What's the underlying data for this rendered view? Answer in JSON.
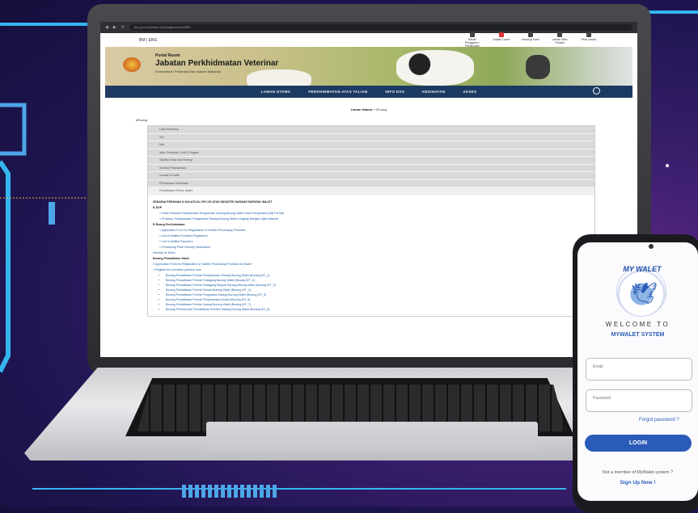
{
  "browser": {
    "url": "dvs.gov.my/index.php/pages/view/3805"
  },
  "gov_bar": {
    "left": "BM | ENG",
    "items": [
      "Aduan Pengguna / Pertanyaan",
      "Soalan Lazim",
      "Hubungi Kami",
      "Laman Web Pautan",
      "Peta Laman"
    ]
  },
  "header": {
    "portal": "Portal Rasmi",
    "title": "Jabatan Perkhidmatan Veterinar",
    "subtitle": "Kementerian Pertanian Dan Industri Makanan"
  },
  "nav": {
    "items": [
      "LAMAN UTAMA",
      "PERKHIDMATAN ATAS TALIAN",
      "INFO DVS",
      "KESIHATAN",
      "AKSES"
    ]
  },
  "breadcrumb": {
    "home": "Laman Utama",
    "current": "» eRuang"
  },
  "page_title": "eRuang",
  "accordion": {
    "items": [
      "Latar Belakang",
      "Visi",
      "Misi",
      "Akta, Peraturan, Unit & Piagam",
      "Takrifan Khas dan Strategi",
      "Senarai Pelaksanaan",
      "Inovasi & Kualiti",
      "Pendaftaran Kesihatan",
      "Pendaftaran Premis Walet"
    ],
    "body_title": "SENARAI PERANAN & HALATUJU JPV KE ATAS INDUSTRI SARANG BURUNG WALET",
    "e_sop": "E-SOP",
    "sop1": "» Garis Panduan Pelaksanaan Pengurusan Sarang Burung Walet untuk Pengusaha (Sijil Permit)",
    "sop2": "» Prosedur Pelaksanaan Pengeluaran Sarang Burung Walet Lengkap Dengan Ujian Makmal",
    "eruang": "E-Ruang Perkhidmatan",
    "er1": "» Application Form for Registration of Swiftlet Processing Premises",
    "er2": "» List of Swiftlet Premises Registered",
    "er3": "» List of Swiftlet Exporters",
    "er4": "» Processing Plant Security Information",
    "back": "Kembali ke Menu",
    "borang": "Borang Pendaftaran Walet",
    "note1": "» Application Form for Registration of Swiftlet Processing Premises for Walet",
    "note2": "» Register the premises premise here",
    "list": [
      "Borang Pendaftaran Premis Pemprosesan Sarang Burung Walet (Borang WT_1)",
      "Borang Pendaftaran Premis Pedagang Burung Walet (Borang WT_2)",
      "Borang Pendaftaran Premis Pedagang Eksport Sarang Burung Walet (Borang WT_3)",
      "Borang Pendaftaran Premis Rumah Burung Walet (Borang WT_4)",
      "Borang Pendaftaran Premis Pengusaha Sarang Burung Walet (Borang WT_5)",
      "Borang Pendaftaran Premis Pemprosesan Kedua (Borang WT_6)",
      "Borang Pendaftaran Premis Sarang Burung Walet (Borang WT_7)",
      "Borang Permohonan Pendaftaran Pembeli Sarang Burung Walet (Borang WT_8)"
    ]
  },
  "phone": {
    "logo_text": "MY WALET",
    "welcome": "WELCOME TO",
    "system": "MYWALET SYSTEM",
    "email_placeholder": "Email",
    "password_placeholder": "Password",
    "forgot": "Forgot password ?",
    "login": "LOGIN",
    "not_member": "Not a member of MyWalet system ?",
    "signup": "Sign Up Now !"
  }
}
